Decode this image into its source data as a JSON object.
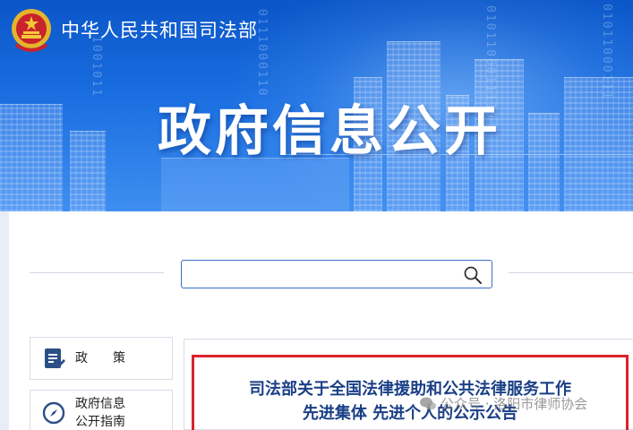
{
  "header": {
    "ministry_name": "中华人民共和国司法部",
    "banner_title": "政府信息公开",
    "binary_strings": [
      "0101100011110",
      "1001011",
      "0111000110",
      "01011000111"
    ],
    "emblem_icon": "national-emblem-icon"
  },
  "search": {
    "value": "",
    "placeholder": "",
    "icon": "search-icon"
  },
  "sidebar": {
    "items": [
      {
        "label": "政　　策",
        "icon": "document-edit-icon"
      },
      {
        "label": "政府信息\n公开指南",
        "icon": "compass-icon"
      }
    ]
  },
  "notice": {
    "title_line1": "司法部关于全国法律援助和公共法律服务工作",
    "title_line2": "先进集体 先进个人的公示公告"
  },
  "watermark": {
    "text": "公众号 · 洛阳市律师协会",
    "icon": "wechat-icon"
  },
  "colors": {
    "banner_blue": "#1a6ee0",
    "accent_red": "#d9232b",
    "title_blue": "#1a3f86",
    "search_border": "#3a6fc4"
  }
}
